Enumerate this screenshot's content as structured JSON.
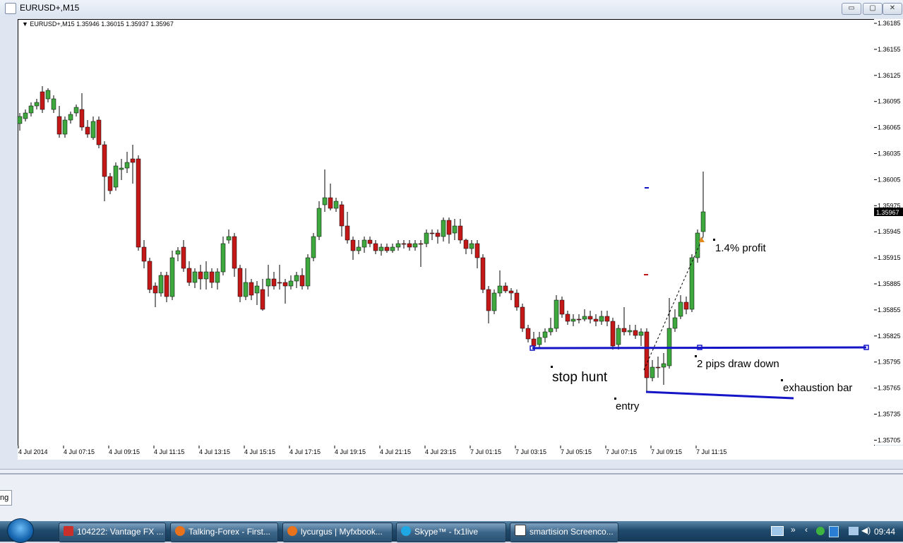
{
  "window": {
    "title": "EURUSD+,M15",
    "buttons": {
      "minimize": "▭",
      "restore": "▢",
      "close": "✕"
    }
  },
  "chart": {
    "header": "EURUSD+,M15  1.35946 1.36015 1.35937 1.35967",
    "current_price": "1.35967",
    "price_labels": [
      "1.36185",
      "1.36155",
      "1.36125",
      "1.36095",
      "1.36065",
      "1.36035",
      "1.36005",
      "1.35975",
      "1.35945",
      "1.35915",
      "1.35885",
      "1.35855",
      "1.35825",
      "1.35795",
      "1.35765",
      "1.35735",
      "1.35705"
    ],
    "time_labels": [
      "4 Jul 2014",
      "4 Jul 07:15",
      "4 Jul 09:15",
      "4 Jul 11:15",
      "4 Jul 13:15",
      "4 Jul 15:15",
      "4 Jul 17:15",
      "4 Jul 19:15",
      "4 Jul 21:15",
      "4 Jul 23:15",
      "7 Jul 01:15",
      "7 Jul 03:15",
      "7 Jul 05:15",
      "7 Jul 07:15",
      "7 Jul 09:15",
      "7 Jul 11:15"
    ],
    "annotations": {
      "profit": "1.4% profit",
      "draw_down": "2 pips draw down",
      "stop_hunt": "stop hunt",
      "exhaustion": "exhaustion bar",
      "entry": "entry"
    },
    "colors": {
      "bull": "#3ea83e",
      "bear": "#c41818",
      "line": "#1515c8"
    }
  },
  "bottom_panel": {
    "tab_label": "ng"
  },
  "taskbar": {
    "items": [
      {
        "label": "104222: Vantage FX ...",
        "icon": "metatrader-icon"
      },
      {
        "label": "Talking-Forex - First...",
        "icon": "firefox-icon"
      },
      {
        "label": "lycurgus | Myfxbook...",
        "icon": "firefox-icon"
      },
      {
        "label": "Skype™ - fx1live",
        "icon": "skype-icon"
      },
      {
        "label": "smartision Screenco...",
        "icon": "screencast-icon"
      }
    ],
    "clock": "09:44"
  }
}
